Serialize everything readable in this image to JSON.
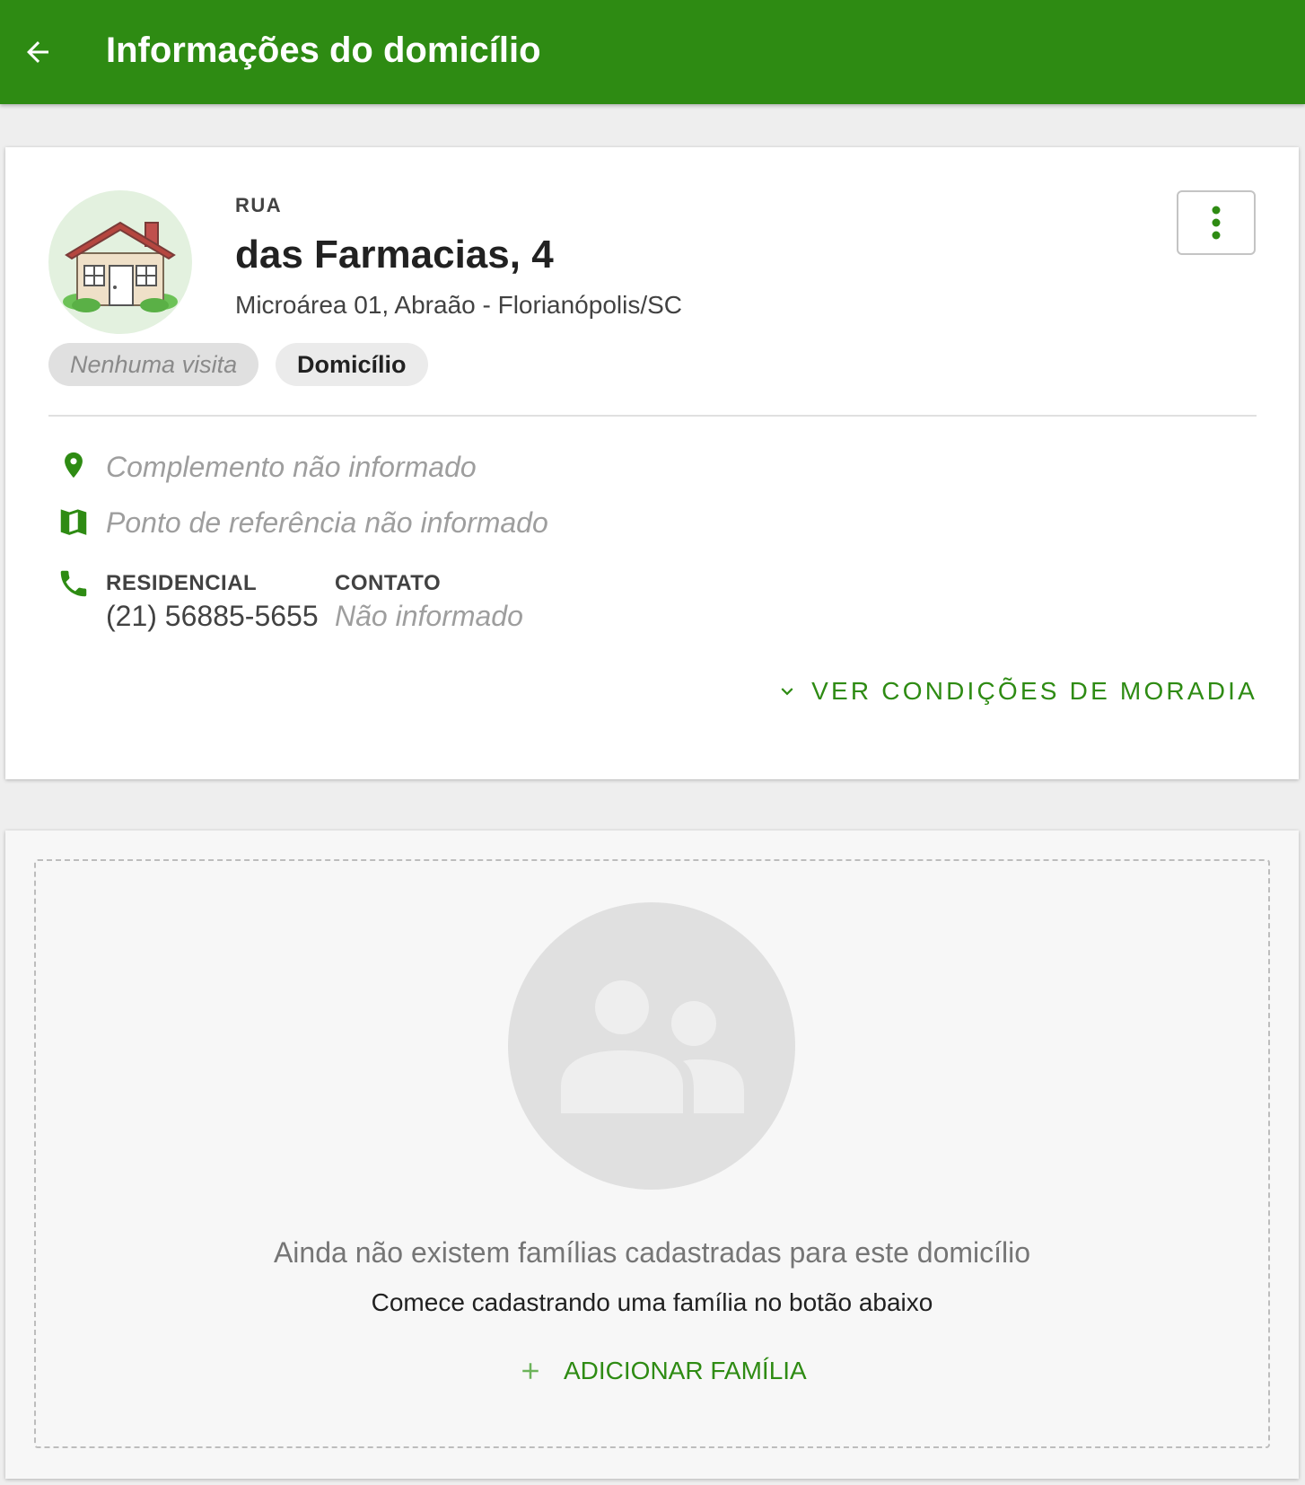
{
  "appbar": {
    "title": "Informações do domicílio",
    "back_icon": "arrow-left-icon",
    "color": "#2e8b13"
  },
  "address": {
    "street_type": "RUA",
    "street_name": "das Farmacias, 4",
    "locality": "Microárea 01, Abraão - Florianópolis/SC",
    "avatar_icon": "house-icon",
    "menu_icon": "more-vertical-icon"
  },
  "chips": {
    "visit": "Nenhuma visita",
    "type": "Domicílio"
  },
  "details": {
    "complement": "Complemento não informado",
    "complement_icon": "location-pin-icon",
    "reference": "Ponto de referência não informado",
    "reference_icon": "map-icon",
    "phone_icon": "phone-icon",
    "residential_label": "RESIDENCIAL",
    "residential_value": "(21) 56885-5655",
    "contact_label": "CONTATO",
    "contact_value": "Não informado"
  },
  "expand": {
    "label": "VER CONDIÇÕES DE MORADIA",
    "icon": "chevron-down-icon"
  },
  "families": {
    "empty_icon": "people-icon",
    "empty_title": "Ainda não existem famílias cadastradas para este domicílio",
    "empty_subtitle": "Comece cadastrando uma família no botão abaixo",
    "add_label": "ADICIONAR FAMÍLIA",
    "add_icon": "plus-icon"
  }
}
